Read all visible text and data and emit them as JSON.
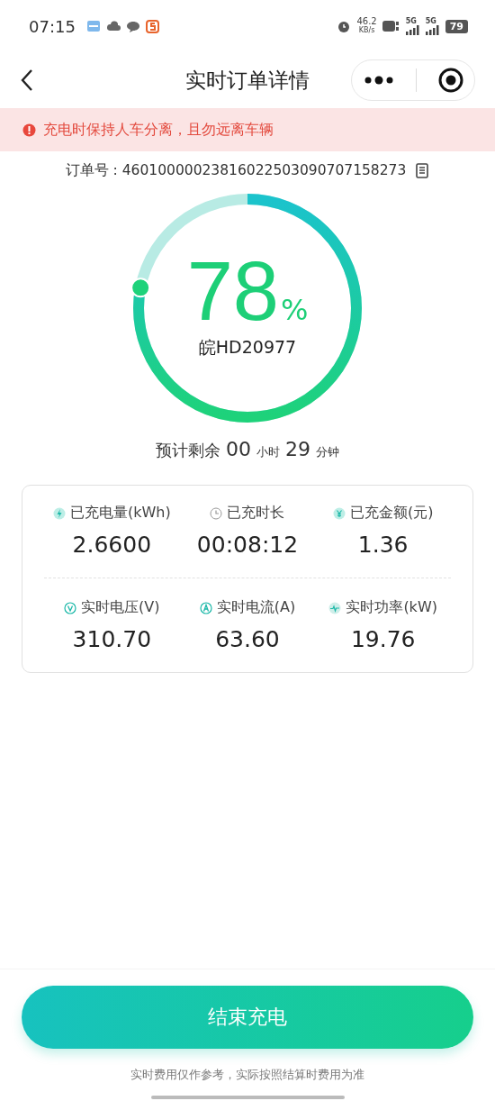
{
  "status_bar": {
    "time": "07:15",
    "speed_value": "46.2",
    "speed_unit": "KB/s",
    "network_labels": [
      "5G",
      "5G"
    ],
    "battery": "79"
  },
  "nav": {
    "title": "实时订单详情"
  },
  "alert": {
    "text": "充电时保持人车分离，且勿远离车辆"
  },
  "order": {
    "label": "订单号 : ",
    "number": "46010000023816022503090707158273"
  },
  "gauge": {
    "level": 0.78,
    "value": "78",
    "unit": "%",
    "plate": "皖HD20977"
  },
  "remaining": {
    "label": "预计剩余",
    "hours": "00",
    "hours_unit": "小时",
    "minutes": "29",
    "minutes_unit": "分钟"
  },
  "metrics": [
    {
      "kind": "energy",
      "label": "已充电量(kWh)",
      "value": "2.6600"
    },
    {
      "kind": "time",
      "label": "已充时长",
      "value": "00:08:12"
    },
    {
      "kind": "money",
      "label": "已充金额(元)",
      "value": "1.36"
    },
    {
      "kind": "voltage",
      "label": "实时电压(V)",
      "value": "310.70"
    },
    {
      "kind": "current",
      "label": "实时电流(A)",
      "value": "63.60"
    },
    {
      "kind": "power",
      "label": "实时功率(kW)",
      "value": "19.76"
    }
  ],
  "button": {
    "label": "结束充电"
  },
  "note": "实时费用仅作参考，实际按照结算时费用为准"
}
